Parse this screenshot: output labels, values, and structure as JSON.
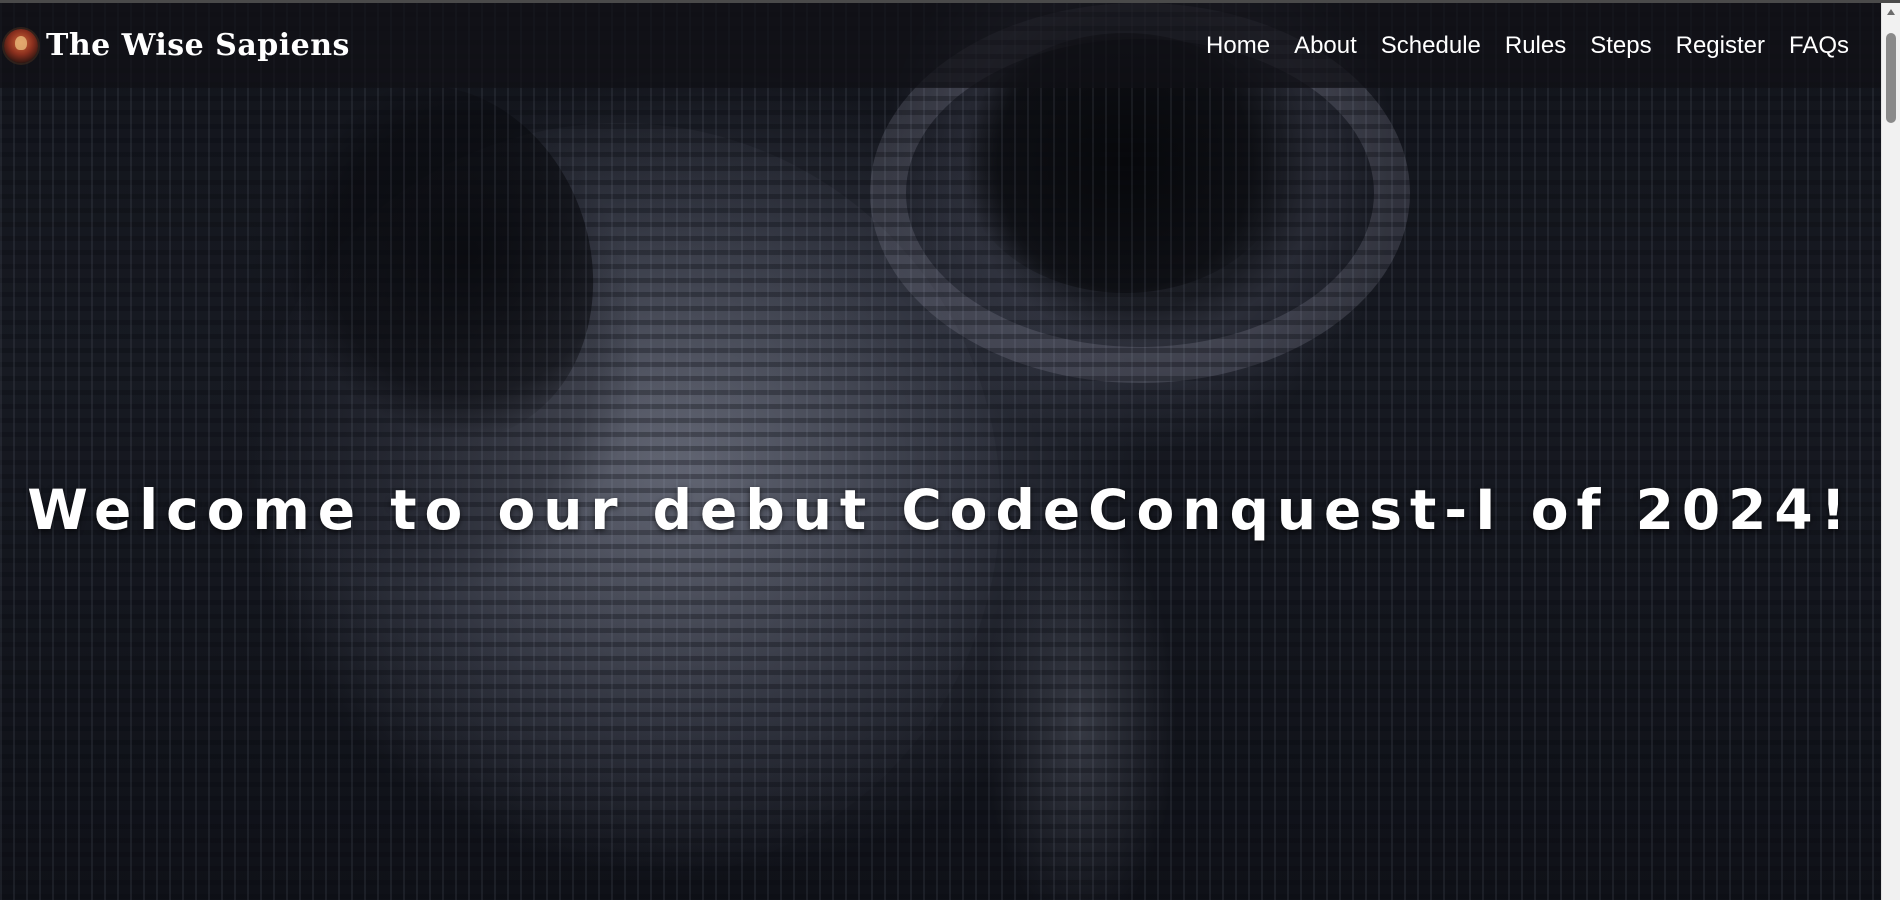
{
  "brand": {
    "name": "The Wise Sapiens",
    "logo_icon": "team-logo-icon"
  },
  "nav": {
    "items": [
      {
        "label": "Home"
      },
      {
        "label": "About"
      },
      {
        "label": "Schedule"
      },
      {
        "label": "Rules"
      },
      {
        "label": "Steps"
      },
      {
        "label": "Register"
      },
      {
        "label": "FAQs"
      }
    ]
  },
  "hero": {
    "title": "Welcome to our debut CodeConquest-I of 2024!",
    "background": "robot-matrix-code-image"
  },
  "colors": {
    "text": "#ffffff",
    "navbar_bg": "#101116",
    "hero_bg": "#171a22"
  }
}
